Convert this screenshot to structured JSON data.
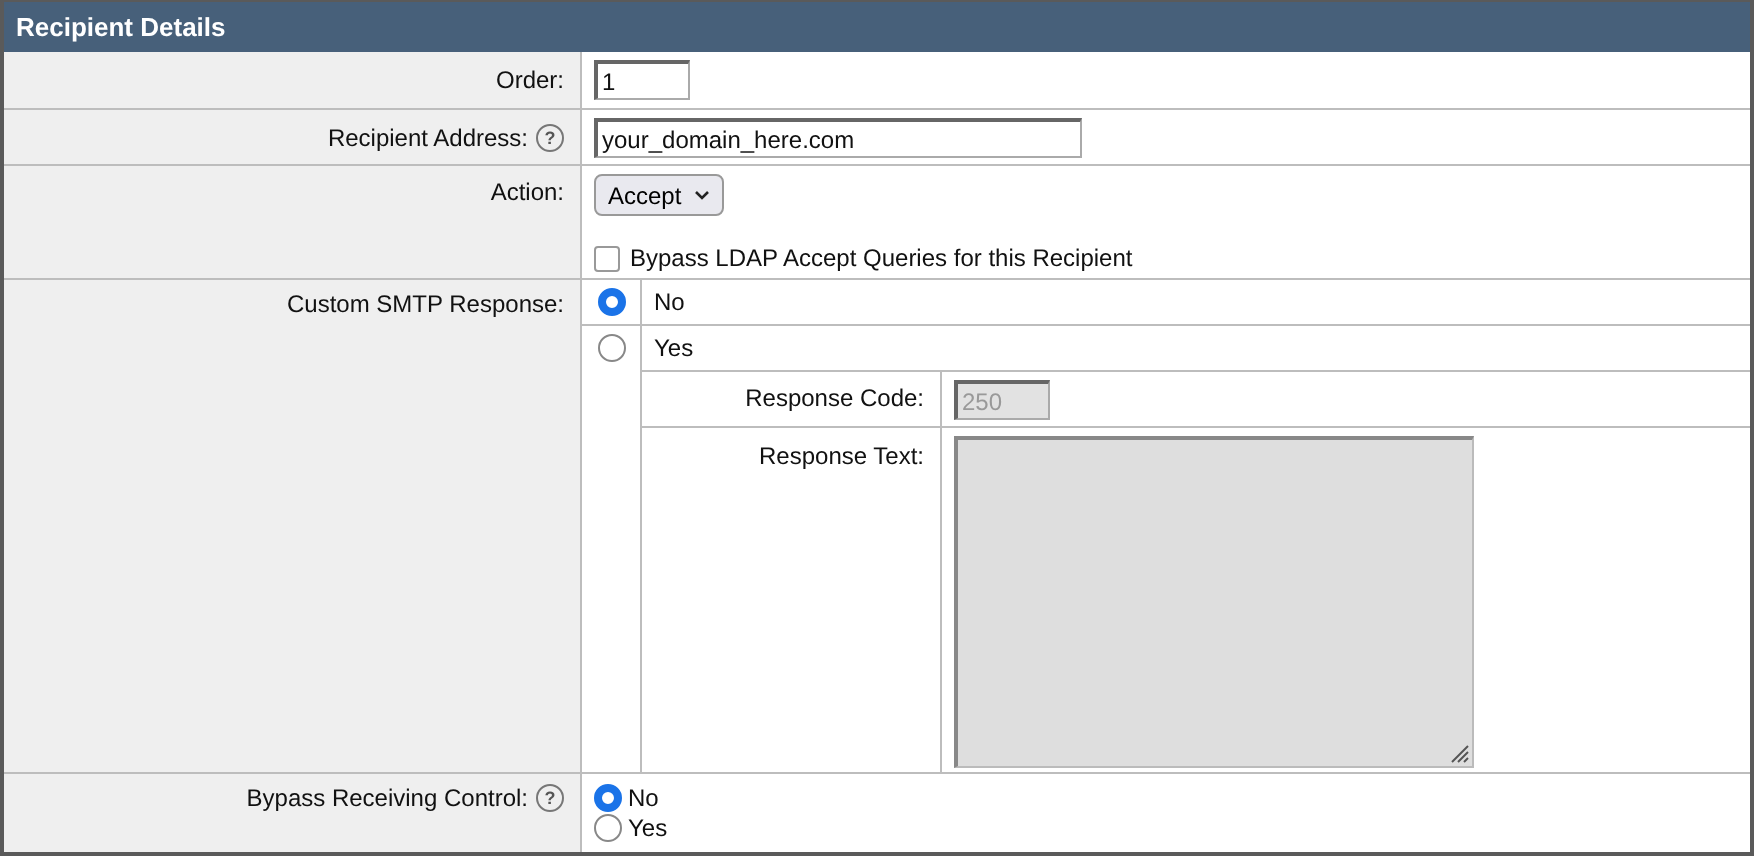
{
  "panel": {
    "title": "Recipient Details"
  },
  "order": {
    "label": "Order:",
    "value": "1"
  },
  "recipient_address": {
    "label": "Recipient Address:",
    "help": "?",
    "value": "your_domain_here.com"
  },
  "action": {
    "label": "Action:",
    "value": "Accept",
    "checkbox": {
      "label": "Bypass LDAP Accept Queries for this Recipient",
      "checked": false
    }
  },
  "custom_smtp_response": {
    "label": "Custom SMTP Response:",
    "options": [
      {
        "label": "No",
        "selected": true
      },
      {
        "label": "Yes",
        "selected": false
      }
    ],
    "response_code": {
      "label": "Response Code:",
      "value": "250",
      "disabled": true
    },
    "response_text": {
      "label": "Response Text:",
      "disabled": true
    }
  },
  "bypass_receiving_control": {
    "label": "Bypass Receiving Control:",
    "help": "?",
    "options": [
      {
        "label": "No",
        "selected": true
      },
      {
        "label": "Yes",
        "selected": false
      }
    ]
  }
}
